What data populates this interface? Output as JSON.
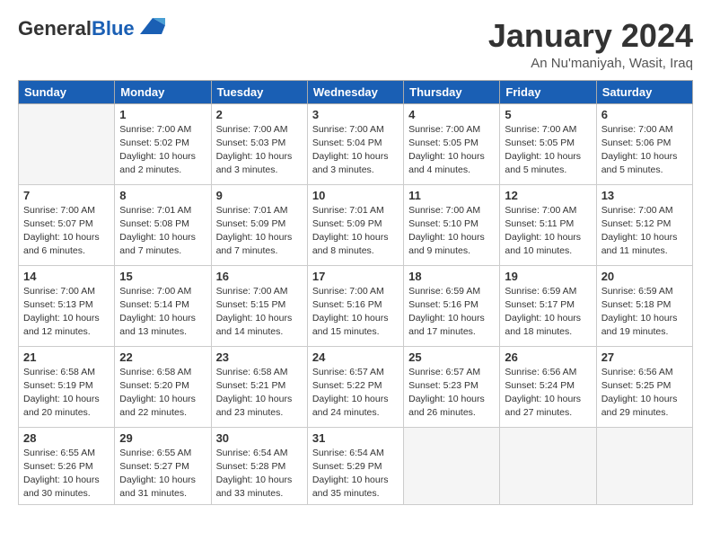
{
  "header": {
    "logo_general": "General",
    "logo_blue": "Blue",
    "month_title": "January 2024",
    "location": "An Nu'maniyah, Wasit, Iraq"
  },
  "days_of_week": [
    "Sunday",
    "Monday",
    "Tuesday",
    "Wednesday",
    "Thursday",
    "Friday",
    "Saturday"
  ],
  "weeks": [
    [
      {
        "day": "",
        "empty": true
      },
      {
        "day": "1",
        "sunrise": "7:00 AM",
        "sunset": "5:02 PM",
        "daylight": "10 hours and 2 minutes."
      },
      {
        "day": "2",
        "sunrise": "7:00 AM",
        "sunset": "5:03 PM",
        "daylight": "10 hours and 3 minutes."
      },
      {
        "day": "3",
        "sunrise": "7:00 AM",
        "sunset": "5:04 PM",
        "daylight": "10 hours and 3 minutes."
      },
      {
        "day": "4",
        "sunrise": "7:00 AM",
        "sunset": "5:05 PM",
        "daylight": "10 hours and 4 minutes."
      },
      {
        "day": "5",
        "sunrise": "7:00 AM",
        "sunset": "5:05 PM",
        "daylight": "10 hours and 5 minutes."
      },
      {
        "day": "6",
        "sunrise": "7:00 AM",
        "sunset": "5:06 PM",
        "daylight": "10 hours and 5 minutes."
      }
    ],
    [
      {
        "day": "7",
        "sunrise": "7:00 AM",
        "sunset": "5:07 PM",
        "daylight": "10 hours and 6 minutes."
      },
      {
        "day": "8",
        "sunrise": "7:01 AM",
        "sunset": "5:08 PM",
        "daylight": "10 hours and 7 minutes."
      },
      {
        "day": "9",
        "sunrise": "7:01 AM",
        "sunset": "5:09 PM",
        "daylight": "10 hours and 7 minutes."
      },
      {
        "day": "10",
        "sunrise": "7:01 AM",
        "sunset": "5:09 PM",
        "daylight": "10 hours and 8 minutes."
      },
      {
        "day": "11",
        "sunrise": "7:00 AM",
        "sunset": "5:10 PM",
        "daylight": "10 hours and 9 minutes."
      },
      {
        "day": "12",
        "sunrise": "7:00 AM",
        "sunset": "5:11 PM",
        "daylight": "10 hours and 10 minutes."
      },
      {
        "day": "13",
        "sunrise": "7:00 AM",
        "sunset": "5:12 PM",
        "daylight": "10 hours and 11 minutes."
      }
    ],
    [
      {
        "day": "14",
        "sunrise": "7:00 AM",
        "sunset": "5:13 PM",
        "daylight": "10 hours and 12 minutes."
      },
      {
        "day": "15",
        "sunrise": "7:00 AM",
        "sunset": "5:14 PM",
        "daylight": "10 hours and 13 minutes."
      },
      {
        "day": "16",
        "sunrise": "7:00 AM",
        "sunset": "5:15 PM",
        "daylight": "10 hours and 14 minutes."
      },
      {
        "day": "17",
        "sunrise": "7:00 AM",
        "sunset": "5:16 PM",
        "daylight": "10 hours and 15 minutes."
      },
      {
        "day": "18",
        "sunrise": "6:59 AM",
        "sunset": "5:16 PM",
        "daylight": "10 hours and 17 minutes."
      },
      {
        "day": "19",
        "sunrise": "6:59 AM",
        "sunset": "5:17 PM",
        "daylight": "10 hours and 18 minutes."
      },
      {
        "day": "20",
        "sunrise": "6:59 AM",
        "sunset": "5:18 PM",
        "daylight": "10 hours and 19 minutes."
      }
    ],
    [
      {
        "day": "21",
        "sunrise": "6:58 AM",
        "sunset": "5:19 PM",
        "daylight": "10 hours and 20 minutes."
      },
      {
        "day": "22",
        "sunrise": "6:58 AM",
        "sunset": "5:20 PM",
        "daylight": "10 hours and 22 minutes."
      },
      {
        "day": "23",
        "sunrise": "6:58 AM",
        "sunset": "5:21 PM",
        "daylight": "10 hours and 23 minutes."
      },
      {
        "day": "24",
        "sunrise": "6:57 AM",
        "sunset": "5:22 PM",
        "daylight": "10 hours and 24 minutes."
      },
      {
        "day": "25",
        "sunrise": "6:57 AM",
        "sunset": "5:23 PM",
        "daylight": "10 hours and 26 minutes."
      },
      {
        "day": "26",
        "sunrise": "6:56 AM",
        "sunset": "5:24 PM",
        "daylight": "10 hours and 27 minutes."
      },
      {
        "day": "27",
        "sunrise": "6:56 AM",
        "sunset": "5:25 PM",
        "daylight": "10 hours and 29 minutes."
      }
    ],
    [
      {
        "day": "28",
        "sunrise": "6:55 AM",
        "sunset": "5:26 PM",
        "daylight": "10 hours and 30 minutes."
      },
      {
        "day": "29",
        "sunrise": "6:55 AM",
        "sunset": "5:27 PM",
        "daylight": "10 hours and 31 minutes."
      },
      {
        "day": "30",
        "sunrise": "6:54 AM",
        "sunset": "5:28 PM",
        "daylight": "10 hours and 33 minutes."
      },
      {
        "day": "31",
        "sunrise": "6:54 AM",
        "sunset": "5:29 PM",
        "daylight": "10 hours and 35 minutes."
      },
      {
        "day": "",
        "empty": true
      },
      {
        "day": "",
        "empty": true
      },
      {
        "day": "",
        "empty": true
      }
    ]
  ]
}
